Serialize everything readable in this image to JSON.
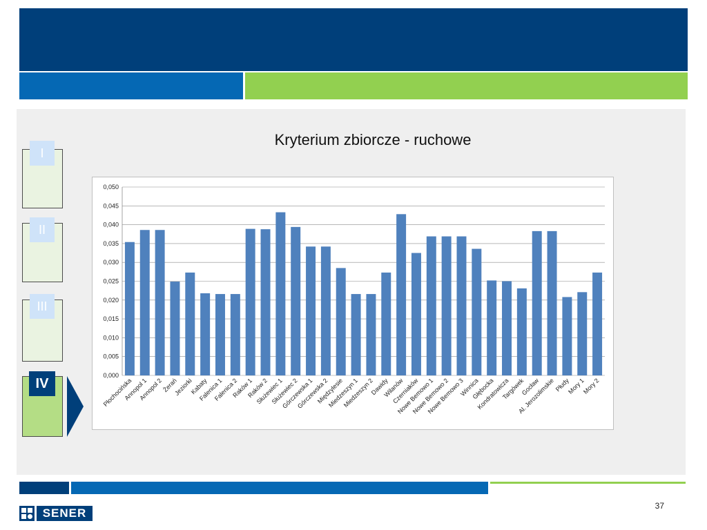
{
  "nav": {
    "items": [
      {
        "label": "I",
        "active": false
      },
      {
        "label": "II",
        "active": false
      },
      {
        "label": "III",
        "active": false
      },
      {
        "label": "IV",
        "active": true
      }
    ]
  },
  "footer": {
    "brand": "SENER",
    "page_number": "37"
  },
  "colors": {
    "navy": "#003f7a",
    "blue": "#0568b4",
    "green": "#92d050",
    "bar": "#4f81bd"
  },
  "chart_data": {
    "type": "bar",
    "title": "Kryterium zbiorcze - ruchowe",
    "xlabel": "",
    "ylabel": "",
    "ylim": [
      0,
      0.05
    ],
    "yticks": [
      "0,000",
      "0,005",
      "0,010",
      "0,015",
      "0,020",
      "0,025",
      "0,030",
      "0,035",
      "0,040",
      "0,045",
      "0,050"
    ],
    "grid": true,
    "categories": [
      "Płochocińska",
      "Annopol 1",
      "Annopol 2",
      "Żerań",
      "Jeziorki",
      "Kabaty",
      "Falenica 1",
      "Falenica 2",
      "Raków 1",
      "Raków 2",
      "Służewiec 1",
      "Służewiec 2",
      "Górczewska 1",
      "Górczewska 2",
      "Międzylesie",
      "Miedzeszyn 1",
      "Miedzeszyn 2",
      "Dawidy",
      "Wilanów",
      "Czerniaków",
      "Nowe Bemowo 1",
      "Nowe Bemowo 2",
      "Nowe Bemowo 3",
      "Winnica",
      "Głębocka",
      "Kondratowicza",
      "Targówek",
      "Gocław",
      "Al. Jerozolimskie",
      "Płudy",
      "Mory 1",
      "Mory 2"
    ],
    "values": [
      0.0354,
      0.0386,
      0.0386,
      0.0249,
      0.0273,
      0.0218,
      0.0216,
      0.0216,
      0.0389,
      0.0388,
      0.0433,
      0.0394,
      0.0342,
      0.0342,
      0.0285,
      0.0216,
      0.0216,
      0.0273,
      0.0428,
      0.0325,
      0.0369,
      0.0369,
      0.0369,
      0.0336,
      0.0252,
      0.025,
      0.0231,
      0.0383,
      0.0383,
      0.0208,
      0.0221,
      0.0273
    ]
  }
}
